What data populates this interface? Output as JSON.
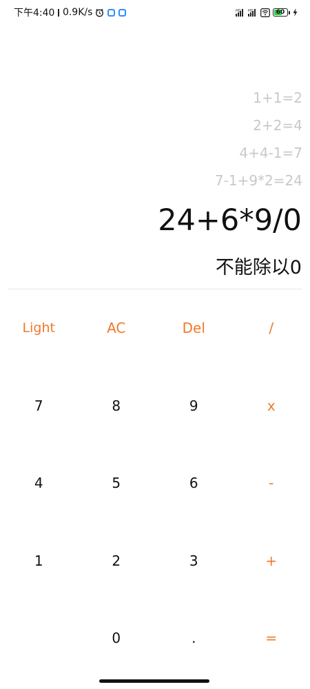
{
  "status_bar": {
    "time": "下午4:40",
    "net_speed": "0.9K/s",
    "icons": [
      "alarm-icon",
      "app-notification-icon",
      "app-notification-icon",
      "signal-icon",
      "signal-icon",
      "wifi-icon",
      "battery-icon",
      "charging-icon"
    ],
    "battery_level": "60",
    "battery_fraction": 0.6
  },
  "display": {
    "history": [
      "1+1=2",
      "2+2=4",
      "4+4-1=7",
      "7-1+9*2=24"
    ],
    "expression": "24+6*9/0",
    "result": "不能除以0"
  },
  "keypad": {
    "rows": [
      [
        "Light",
        "AC",
        "Del",
        "/"
      ],
      [
        "7",
        "8",
        "9",
        "x"
      ],
      [
        "4",
        "5",
        "6",
        "-"
      ],
      [
        "1",
        "2",
        "3",
        "+"
      ],
      [
        "",
        "0",
        ".",
        "="
      ]
    ]
  },
  "colors": {
    "accent": "#f0782b",
    "history_text": "#c8c8c8",
    "primary_text": "#111111",
    "background": "#ffffff"
  }
}
